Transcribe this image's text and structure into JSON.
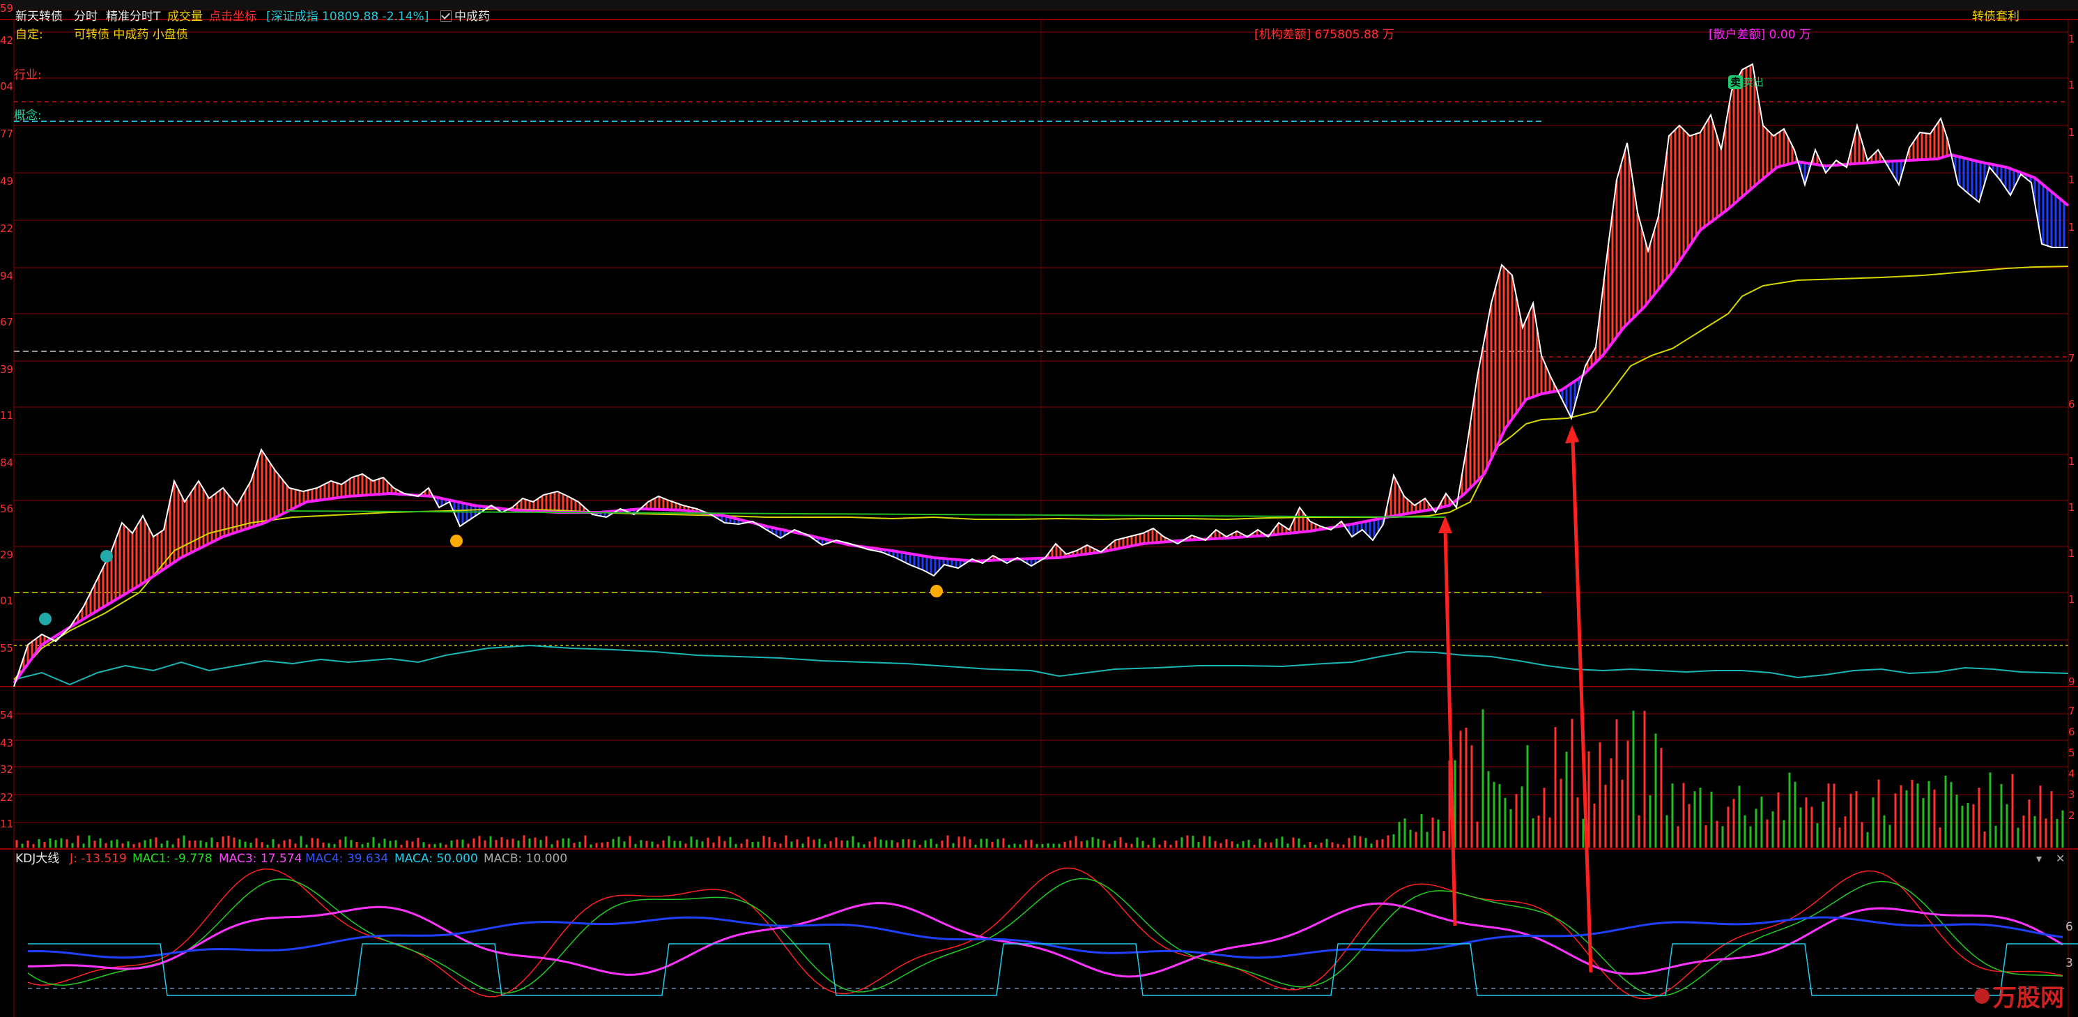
{
  "header": {
    "stock_name": "新天转债",
    "mode": "分时",
    "chart_type": "精准分时T",
    "volume_label": "成交量",
    "click_coord_label": "点击坐标",
    "index_info": "[深证成指 10809.88 -2.14%]",
    "stock_tag": "中成药",
    "right_link": "转债套利"
  },
  "row2": {
    "custom_label": "自定:",
    "custom_tags": "可转债 中成药 小盘债",
    "inst_diff": "[机构差额] 675805.88 万",
    "retail_diff": "[散户差额] 0.00 万"
  },
  "labels": {
    "industry": "行业:",
    "concept": "概念:",
    "sell_marker": "卖出"
  },
  "left_axis": [
    "59",
    "42",
    "04",
    "77",
    "49",
    "22",
    "94",
    "67",
    "39",
    "11",
    "84",
    "56",
    "29",
    "01",
    "55"
  ],
  "right_axis": [
    "1",
    "1",
    "1",
    "1",
    "1",
    "7",
    "6",
    "1",
    "1",
    "1",
    "1",
    "9"
  ],
  "volume_axis": [
    "54",
    "43",
    "32",
    "22",
    "11"
  ],
  "volume_axis_right": [
    "7",
    "6",
    "5",
    "4",
    "3",
    "2"
  ],
  "kdj": {
    "title": "KDJ大线",
    "j": "J: -13.519",
    "mac1": "MAC1: -9.778",
    "mac3": "MAC3: 17.574",
    "mac4": "MAC4: 39.634",
    "maca": "MACA: 50.000",
    "macb": "MACB: 10.000",
    "right_axis": [
      "6",
      "3"
    ]
  },
  "colors": {
    "up": "#ff3b30",
    "down": "#1e3cff",
    "price_line": "#ffffff",
    "avg_line": "#ff22ff",
    "yellow_line": "#d7d700",
    "cyan": "#19b6b6",
    "grid_red": "#8a0000",
    "arrow": "#ff2020"
  },
  "watermark": "万股网"
}
